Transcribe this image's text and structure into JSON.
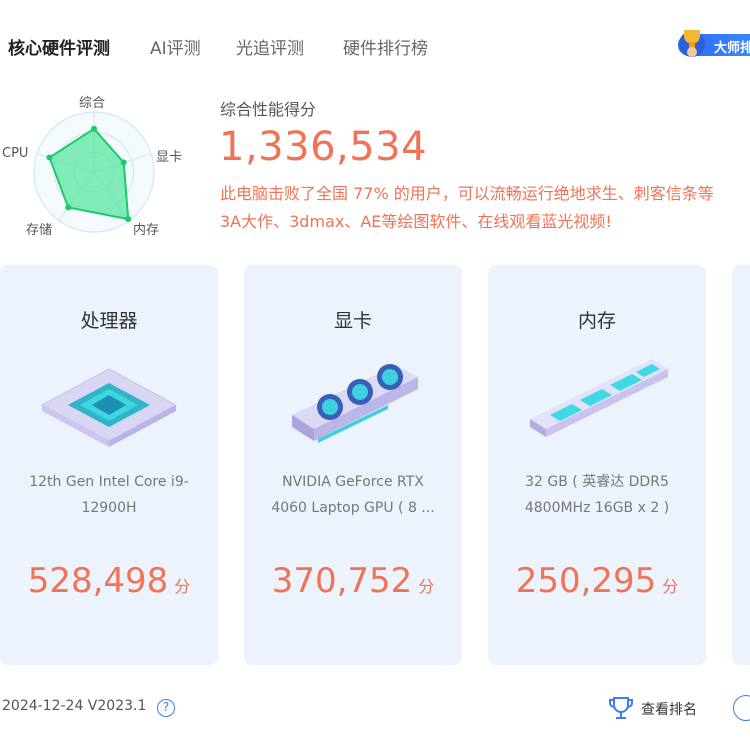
{
  "tabs": [
    {
      "label": "核心硬件评测"
    },
    {
      "label": "AI评测"
    },
    {
      "label": "光追评测"
    },
    {
      "label": "硬件排行榜"
    }
  ],
  "badge": {
    "label": "大师排"
  },
  "radar": {
    "labels": [
      "综合",
      "显卡",
      "内存",
      "存储",
      "CPU"
    ],
    "values": [
      0.72,
      0.52,
      0.97,
      0.73,
      0.78
    ],
    "colors": {
      "fill": "#5ae6a0",
      "stroke": "#1ec96a",
      "grid": "#cfe6f9"
    }
  },
  "score": {
    "label": "综合性能得分",
    "value": "1,336,534",
    "desc_line1": "此电脑击败了全国 77% 的用户，可以流畅运行绝地求生、刺客信条等",
    "desc_line2": "3A大作、3dmax、AE等绘图软件、在线观看蓝光视频!"
  },
  "cards": [
    {
      "title": "处理器",
      "name_line1": "12th Gen Intel Core i9-",
      "name_line2": "12900H",
      "score": "528,498",
      "unit": "分",
      "icon": "cpu-icon"
    },
    {
      "title": "显卡",
      "name_line1": "NVIDIA GeForce RTX",
      "name_line2": "4060 Laptop GPU ( 8 ...",
      "score": "370,752",
      "unit": "分",
      "icon": "gpu-icon"
    },
    {
      "title": "内存",
      "name_line1": "32 GB ( 英睿达 DDR5",
      "name_line2": "4800MHz 16GB x 2 )",
      "score": "250,295",
      "unit": "分",
      "icon": "ram-icon"
    }
  ],
  "footer": {
    "date_version": "2024-12-24 V2023.1",
    "help": "?",
    "rank_label": "查看排名"
  },
  "colors": {
    "accent": "#f07357",
    "brand": "#3d7cf5",
    "card_bg": "#ecf3fd"
  }
}
